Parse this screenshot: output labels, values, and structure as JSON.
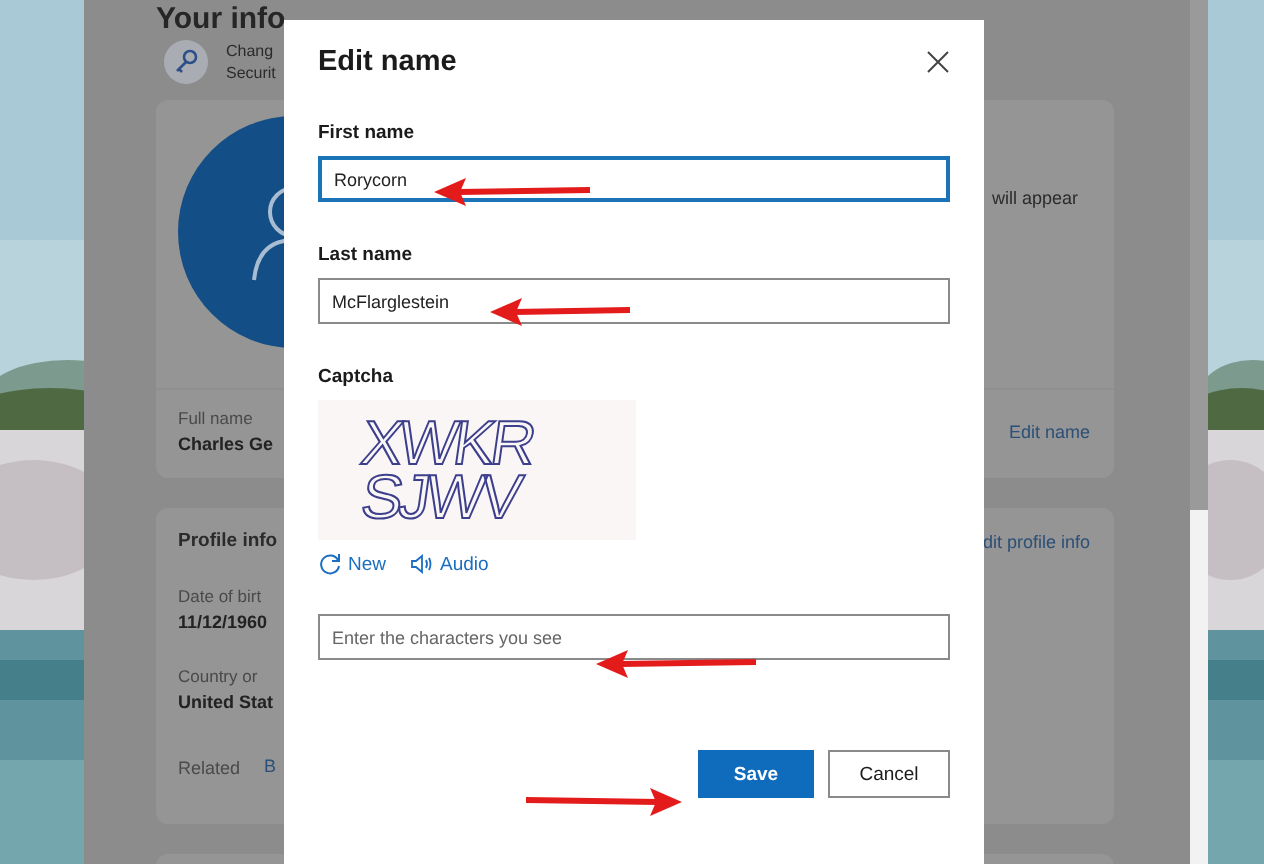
{
  "background_page": {
    "title": "Your info",
    "security_item": {
      "title": "Chang",
      "subtitle": "Securit"
    },
    "name_card": {
      "side_text": "will appear",
      "field_label": "Full name",
      "field_value": "Charles Ge",
      "link": "Edit name"
    },
    "profile_card": {
      "title": "Profile info",
      "link": "dit profile info",
      "fields": [
        {
          "label": "Date of birt",
          "value": "11/12/1960"
        },
        {
          "label": "Country or",
          "value": "United Stat"
        }
      ],
      "related_label": "Related",
      "related_link": "B"
    }
  },
  "dialog": {
    "title": "Edit name",
    "fields": [
      {
        "label": "First name",
        "value": "Rorycorn",
        "focused": true
      },
      {
        "label": "Last name",
        "value": "McFlarglestein",
        "focused": false
      }
    ],
    "captcha": {
      "label": "Captcha",
      "lines": [
        "XWKR",
        "SJWV"
      ],
      "actions": [
        {
          "label": "New",
          "kind": "refresh"
        },
        {
          "label": "Audio",
          "kind": "audio"
        }
      ],
      "answer": {
        "placeholder": "Enter the characters you see"
      }
    },
    "buttons": [
      {
        "label": "Save",
        "kind": "primary"
      },
      {
        "label": "Cancel",
        "kind": "secondary"
      }
    ]
  }
}
